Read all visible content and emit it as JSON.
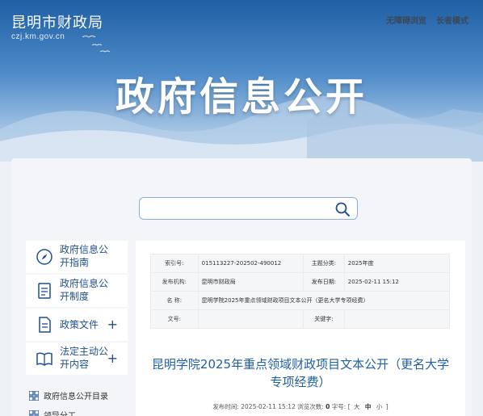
{
  "header": {
    "site_name": "昆明市财政局",
    "domain": "czj.km.gov.cn",
    "links": [
      "无障碍浏览",
      "长者模式"
    ],
    "banner_title": "政府信息公开"
  },
  "search": {
    "placeholder": ""
  },
  "sidebar": {
    "items": [
      {
        "label": "政府信息公开指南",
        "icon": "compass-icon",
        "has_plus": false
      },
      {
        "label": "政府信息公开制度",
        "icon": "document-icon",
        "has_plus": false
      },
      {
        "label": "政策文件",
        "icon": "file-icon",
        "has_plus": true,
        "plus": "+"
      },
      {
        "label": "法定主动公开内容",
        "icon": "book-icon",
        "has_plus": true,
        "plus": "+"
      }
    ],
    "links": [
      {
        "label": "政府信息公开目录",
        "icon": "grid-icon"
      },
      {
        "label": "领导分工",
        "icon": "grid-icon"
      }
    ]
  },
  "doc": {
    "meta": {
      "index_label": "索引号:",
      "index_value": "015113227-202502-490012",
      "topic_label": "主题分类:",
      "topic_value": "2025年度",
      "org_label": "发布机构:",
      "org_value": "昆明市财政局",
      "date_label": "发布日期:",
      "date_value": "2025-02-11 15:12",
      "name_label": "名 称:",
      "name_value": "昆明学院2025年重点领域财政项目文本公开（更名大学专项经费）",
      "docno_label": "文号:",
      "docno_value": "",
      "keyword_label": "关键字:",
      "keyword_value": ""
    },
    "title": "昆明学院2025年重点领域财政项目文本公开（更名大学专项经费）",
    "time_label": "发布时间:",
    "time_value": "2025-02-11 15:12",
    "views_label": "浏览次数:",
    "views_value": "0",
    "font_label": "字号:",
    "font_open": "[",
    "font_large": "大",
    "font_medium": "中",
    "font_small": "小",
    "font_close": "]"
  }
}
